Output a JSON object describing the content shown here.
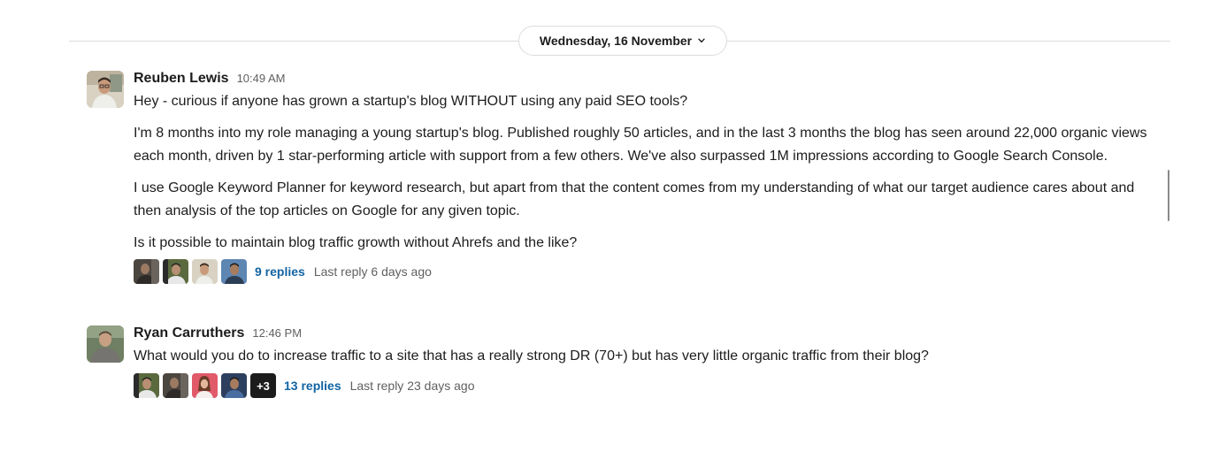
{
  "divider": {
    "date_label": "Wednesday, 16 November"
  },
  "messages": [
    {
      "author": "Reuben Lewis",
      "time": "10:49 AM",
      "paragraphs": [
        "Hey - curious if anyone has grown a startup's blog WITHOUT using any paid SEO tools?",
        "I'm 8 months into my role managing a young startup's blog. Published roughly 50 articles, and in the last 3 months the blog has seen around 22,000 organic views each month, driven by 1 star-performing article with support from a few others. We've also surpassed 1M impressions according to Google Search Console.",
        "I use Google Keyword Planner for keyword research, but apart from that the content comes from my understanding of what our target audience cares about and then analysis of the top articles on Google for any given topic.",
        "Is it possible to maintain blog traffic growth without Ahrefs and the like?"
      ],
      "thread": {
        "replies_label": "9 replies",
        "last_reply": "Last reply 6 days ago"
      }
    },
    {
      "author": "Ryan Carruthers",
      "time": "12:46 PM",
      "paragraphs": [
        "What would you do to increase traffic to a site that has a really strong DR (70+) but has very little organic traffic from their blog?"
      ],
      "thread": {
        "more_count": "+3",
        "replies_label": "13 replies",
        "last_reply": "Last reply 23 days ago"
      }
    }
  ],
  "colors": {
    "link": "#1264a3",
    "muted": "#616061",
    "text": "#1d1c1d",
    "divider": "#dddddd"
  },
  "icons": {
    "date_dropdown": "chevron-down-icon"
  }
}
